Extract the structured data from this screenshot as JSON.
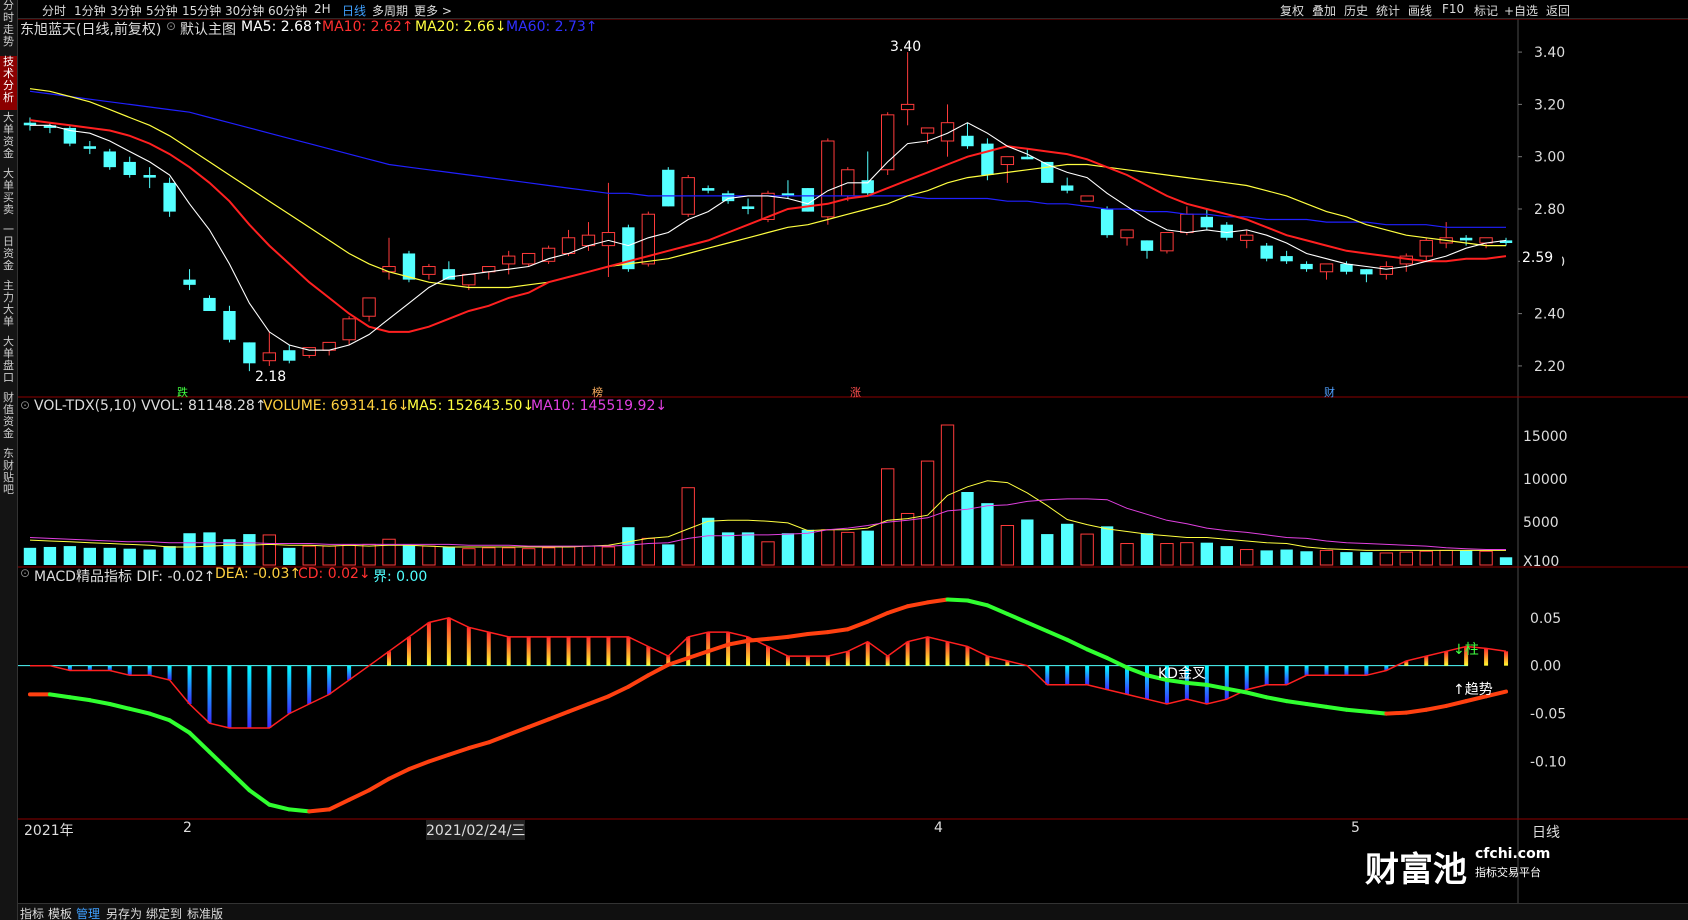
{
  "sidebar": [
    "分时走势",
    "技术分析",
    "大单资金",
    "大单买卖",
    "一日资金",
    "主力大单",
    "大单盘口",
    "财值资金",
    "东财贴吧"
  ],
  "periods": [
    "分时",
    "1分钟",
    "3分钟",
    "5分钟",
    "15分钟",
    "30分钟",
    "60分钟",
    "2H",
    "日线",
    "多周期",
    "更多 >"
  ],
  "tools": [
    "复权",
    "叠加",
    "历史",
    "统计",
    "画线",
    "F10",
    "标记",
    "+自选",
    "返回"
  ],
  "main_header": {
    "title": "东旭蓝天(日线,前复权)",
    "template": "默认主图",
    "ma5": "MA5: 2.68↑",
    "ma10": "MA10: 2.62↑",
    "ma20": "MA20: 2.66↓",
    "ma60": "MA60: 2.73↑"
  },
  "vol_header": {
    "name": "VOL-TDX(5,10) VVOL: 81148.28↑",
    "volume": "VOLUME: 69314.16↓",
    "ma5": "MA5: 152643.50↓",
    "ma10": "MA10: 145519.92↓"
  },
  "macd_header": {
    "name": "MACD精品指标 DIF: -0.02↑",
    "dea": "DEA: -0.03↑",
    "cd": "CD: 0.02↓",
    "jie": "界: 0.00"
  },
  "price_axis": [
    "3.40",
    "3.20",
    "3.00",
    "2.80",
    "2.60",
    "2.40",
    "2.20"
  ],
  "price_marker": "2.59",
  "vol_axis": [
    "15000",
    "10000",
    "5000",
    "X100"
  ],
  "macd_axis": [
    "0.05",
    "0.00",
    "-0.05",
    "-0.10"
  ],
  "annotations": {
    "high": "3.40",
    "low": "2.18",
    "kd": "KD金叉",
    "zhu": "↓柱",
    "trend": "↑趋势",
    "marks": [
      "跌",
      "榜",
      "涨",
      "财"
    ]
  },
  "dates": [
    "2021年",
    "2",
    "2021/02/24/三",
    "4",
    "5"
  ],
  "period_label": "日线",
  "bottom_tabs": [
    "指标",
    "模板",
    "管理",
    "另存为",
    "绑定到",
    "标准版"
  ],
  "logo": {
    "brand": "财富池",
    "site": "cfchi.com",
    "slogan": "指标交易平台"
  },
  "colors": {
    "up": "#ff3b3b",
    "down": "#54ffff",
    "ma5": "#ffffff",
    "ma10": "#ff2020",
    "ma20": "#ffff40",
    "ma60": "#2020ff"
  },
  "chart_data": {
    "type": "candlestick",
    "price_ylim": [
      2.15,
      3.45
    ],
    "candles": [
      [
        3.13,
        3.15,
        3.1,
        3.12
      ],
      [
        3.12,
        3.13,
        3.09,
        3.11
      ],
      [
        3.11,
        3.12,
        3.04,
        3.05
      ],
      [
        3.04,
        3.06,
        3.01,
        3.03
      ],
      [
        3.02,
        3.03,
        2.95,
        2.96
      ],
      [
        2.98,
        3.0,
        2.92,
        2.93
      ],
      [
        2.93,
        2.96,
        2.88,
        2.92
      ],
      [
        2.9,
        2.92,
        2.77,
        2.79
      ],
      [
        2.53,
        2.57,
        2.49,
        2.51
      ],
      [
        2.46,
        2.47,
        2.41,
        2.41
      ],
      [
        2.41,
        2.43,
        2.29,
        2.3
      ],
      [
        2.29,
        2.29,
        2.18,
        2.21
      ],
      [
        2.22,
        2.33,
        2.2,
        2.25
      ],
      [
        2.26,
        2.28,
        2.21,
        2.22
      ],
      [
        2.24,
        2.27,
        2.23,
        2.27
      ],
      [
        2.26,
        2.29,
        2.24,
        2.29
      ],
      [
        2.3,
        2.39,
        2.28,
        2.38
      ],
      [
        2.39,
        2.46,
        2.37,
        2.46
      ],
      [
        2.56,
        2.69,
        2.53,
        2.58
      ],
      [
        2.63,
        2.64,
        2.52,
        2.53
      ],
      [
        2.55,
        2.59,
        2.53,
        2.58
      ],
      [
        2.57,
        2.6,
        2.53,
        2.53
      ],
      [
        2.51,
        2.55,
        2.49,
        2.55
      ],
      [
        2.56,
        2.58,
        2.53,
        2.58
      ],
      [
        2.59,
        2.64,
        2.55,
        2.62
      ],
      [
        2.59,
        2.63,
        2.58,
        2.63
      ],
      [
        2.6,
        2.66,
        2.59,
        2.65
      ],
      [
        2.63,
        2.72,
        2.62,
        2.69
      ],
      [
        2.66,
        2.75,
        2.64,
        2.7
      ],
      [
        2.66,
        2.9,
        2.54,
        2.71
      ],
      [
        2.73,
        2.74,
        2.56,
        2.57
      ],
      [
        2.59,
        2.79,
        2.58,
        2.78
      ],
      [
        2.95,
        2.96,
        2.81,
        2.81
      ],
      [
        2.78,
        2.93,
        2.77,
        2.92
      ],
      [
        2.88,
        2.89,
        2.86,
        2.87
      ],
      [
        2.86,
        2.87,
        2.82,
        2.83
      ],
      [
        2.81,
        2.84,
        2.78,
        2.8
      ],
      [
        2.76,
        2.87,
        2.75,
        2.86
      ],
      [
        2.86,
        2.91,
        2.84,
        2.85
      ],
      [
        2.88,
        2.88,
        2.79,
        2.79
      ],
      [
        2.77,
        3.07,
        2.74,
        3.06
      ],
      [
        2.85,
        2.96,
        2.83,
        2.95
      ],
      [
        2.91,
        3.02,
        2.85,
        2.86
      ],
      [
        2.95,
        3.17,
        2.93,
        3.16
      ],
      [
        3.18,
        3.4,
        3.12,
        3.2
      ],
      [
        3.09,
        3.11,
        3.05,
        3.11
      ],
      [
        3.06,
        3.2,
        3.0,
        3.13
      ],
      [
        3.08,
        3.13,
        3.03,
        3.04
      ],
      [
        3.05,
        3.07,
        2.91,
        2.93
      ],
      [
        2.97,
        3.0,
        2.9,
        3.0
      ],
      [
        3.0,
        3.03,
        2.99,
        2.99
      ],
      [
        2.98,
        2.98,
        2.9,
        2.9
      ],
      [
        2.89,
        2.92,
        2.86,
        2.87
      ],
      [
        2.83,
        2.85,
        2.83,
        2.85
      ],
      [
        2.8,
        2.81,
        2.69,
        2.7
      ],
      [
        2.69,
        2.72,
        2.66,
        2.72
      ],
      [
        2.68,
        2.68,
        2.61,
        2.64
      ],
      [
        2.64,
        2.71,
        2.63,
        2.71
      ],
      [
        2.71,
        2.81,
        2.7,
        2.78
      ],
      [
        2.77,
        2.8,
        2.72,
        2.73
      ],
      [
        2.74,
        2.75,
        2.68,
        2.69
      ],
      [
        2.68,
        2.72,
        2.65,
        2.7
      ],
      [
        2.66,
        2.67,
        2.6,
        2.61
      ],
      [
        2.62,
        2.64,
        2.59,
        2.6
      ],
      [
        2.59,
        2.6,
        2.56,
        2.57
      ],
      [
        2.56,
        2.58,
        2.53,
        2.59
      ],
      [
        2.59,
        2.6,
        2.55,
        2.56
      ],
      [
        2.57,
        2.57,
        2.52,
        2.55
      ],
      [
        2.55,
        2.6,
        2.53,
        2.58
      ],
      [
        2.59,
        2.63,
        2.56,
        2.62
      ],
      [
        2.62,
        2.69,
        2.6,
        2.68
      ],
      [
        2.67,
        2.75,
        2.65,
        2.69
      ],
      [
        2.69,
        2.7,
        2.66,
        2.68
      ],
      [
        2.67,
        2.69,
        2.65,
        2.69
      ],
      [
        2.68,
        2.69,
        2.66,
        2.67
      ]
    ],
    "ma5": [
      3.12,
      3.12,
      3.1,
      3.09,
      3.06,
      3.02,
      2.98,
      2.93,
      2.82,
      2.72,
      2.59,
      2.44,
      2.33,
      2.28,
      2.26,
      2.26,
      2.28,
      2.32,
      2.38,
      2.44,
      2.5,
      2.54,
      2.55,
      2.56,
      2.57,
      2.58,
      2.61,
      2.63,
      2.66,
      2.68,
      2.66,
      2.69,
      2.71,
      2.76,
      2.79,
      2.84,
      2.85,
      2.85,
      2.84,
      2.82,
      2.87,
      2.9,
      2.9,
      2.98,
      3.05,
      3.06,
      3.09,
      3.13,
      3.09,
      3.04,
      3.01,
      2.97,
      2.94,
      2.92,
      2.86,
      2.81,
      2.76,
      2.72,
      2.71,
      2.72,
      2.71,
      2.72,
      2.7,
      2.67,
      2.63,
      2.61,
      2.59,
      2.58,
      2.57,
      2.58,
      2.6,
      2.62,
      2.65,
      2.67,
      2.68
    ],
    "ma10": [
      3.14,
      3.13,
      3.12,
      3.11,
      3.1,
      3.08,
      3.05,
      3.01,
      2.96,
      2.9,
      2.83,
      2.74,
      2.66,
      2.59,
      2.52,
      2.46,
      2.4,
      2.35,
      2.33,
      2.33,
      2.35,
      2.38,
      2.41,
      2.43,
      2.46,
      2.48,
      2.52,
      2.54,
      2.56,
      2.58,
      2.6,
      2.62,
      2.64,
      2.66,
      2.68,
      2.71,
      2.74,
      2.77,
      2.8,
      2.81,
      2.82,
      2.84,
      2.85,
      2.88,
      2.91,
      2.94,
      2.97,
      3.0,
      3.02,
      3.04,
      3.03,
      3.02,
      3.01,
      2.99,
      2.96,
      2.93,
      2.89,
      2.85,
      2.82,
      2.8,
      2.78,
      2.76,
      2.73,
      2.7,
      2.68,
      2.66,
      2.64,
      2.63,
      2.62,
      2.61,
      2.6,
      2.6,
      2.61,
      2.61,
      2.62
    ],
    "ma20": [
      3.26,
      3.25,
      3.23,
      3.21,
      3.18,
      3.15,
      3.12,
      3.08,
      3.03,
      2.98,
      2.93,
      2.88,
      2.83,
      2.78,
      2.73,
      2.68,
      2.63,
      2.59,
      2.56,
      2.54,
      2.52,
      2.51,
      2.5,
      2.5,
      2.5,
      2.51,
      2.52,
      2.54,
      2.56,
      2.58,
      2.59,
      2.6,
      2.61,
      2.63,
      2.65,
      2.67,
      2.69,
      2.71,
      2.73,
      2.74,
      2.76,
      2.78,
      2.8,
      2.82,
      2.85,
      2.87,
      2.9,
      2.92,
      2.93,
      2.94,
      2.95,
      2.96,
      2.97,
      2.97,
      2.96,
      2.95,
      2.94,
      2.93,
      2.92,
      2.91,
      2.9,
      2.89,
      2.87,
      2.85,
      2.82,
      2.79,
      2.77,
      2.74,
      2.72,
      2.7,
      2.69,
      2.68,
      2.67,
      2.66,
      2.66
    ],
    "ma60": [
      3.25,
      3.24,
      3.23,
      3.22,
      3.21,
      3.2,
      3.19,
      3.18,
      3.17,
      3.15,
      3.13,
      3.11,
      3.09,
      3.07,
      3.05,
      3.03,
      3.01,
      2.99,
      2.97,
      2.96,
      2.95,
      2.94,
      2.93,
      2.92,
      2.91,
      2.9,
      2.89,
      2.88,
      2.87,
      2.86,
      2.86,
      2.85,
      2.85,
      2.85,
      2.85,
      2.85,
      2.85,
      2.85,
      2.85,
      2.85,
      2.85,
      2.85,
      2.85,
      2.85,
      2.85,
      2.84,
      2.84,
      2.84,
      2.84,
      2.83,
      2.83,
      2.82,
      2.82,
      2.81,
      2.8,
      2.8,
      2.79,
      2.79,
      2.78,
      2.78,
      2.77,
      2.77,
      2.76,
      2.76,
      2.76,
      2.75,
      2.75,
      2.75,
      2.74,
      2.74,
      2.74,
      2.73,
      2.73,
      2.73,
      2.73
    ],
    "volume_ylim": [
      0,
      17000
    ],
    "volume": [
      2000,
      2100,
      2200,
      2000,
      2000,
      1900,
      1800,
      2200,
      3700,
      3800,
      3000,
      3600,
      3500,
      2000,
      2200,
      2200,
      2300,
      2400,
      3000,
      2300,
      2200,
      2100,
      1900,
      2000,
      2000,
      1900,
      2000,
      2100,
      2200,
      2100,
      4400,
      3100,
      2400,
      9000,
      5500,
      3800,
      3800,
      2700,
      3700,
      4100,
      4100,
      3800,
      4000,
      11200,
      6000,
      12100,
      16300,
      8500,
      7200,
      4600,
      5300,
      3600,
      4800,
      3600,
      4500,
      2500,
      3700,
      2500,
      2600,
      2600,
      2200,
      1800,
      1700,
      1800,
      1600,
      1700,
      1500,
      1500,
      1400,
      1500,
      1600,
      1700,
      1700,
      1600,
      900
    ],
    "vol_ma5": [
      2900,
      2800,
      2700,
      2600,
      2500,
      2400,
      2300,
      2100,
      2100,
      2200,
      2300,
      2300,
      2400,
      2300,
      2300,
      2200,
      2300,
      2200,
      2300,
      2300,
      2200,
      2100,
      2100,
      2100,
      2100,
      2100,
      2100,
      2100,
      2200,
      2300,
      2700,
      3100,
      3300,
      4200,
      5100,
      5200,
      5200,
      5100,
      4900,
      4000,
      4100,
      4100,
      4300,
      5200,
      5400,
      5800,
      8100,
      9100,
      9800,
      9600,
      8400,
      6900,
      5300,
      4700,
      4200,
      3900,
      3600,
      3400,
      3200,
      3200,
      3000,
      2800,
      2600,
      2500,
      2100,
      1900,
      1800,
      1700,
      1700,
      1700,
      1700,
      1700,
      1700,
      1700,
      1700
    ],
    "vol_ma10": [
      3200,
      3100,
      3000,
      2900,
      2800,
      2700,
      2700,
      2600,
      2600,
      2600,
      2600,
      2600,
      2500,
      2500,
      2500,
      2400,
      2400,
      2400,
      2400,
      2400,
      2400,
      2400,
      2300,
      2300,
      2300,
      2200,
      2200,
      2200,
      2200,
      2200,
      2300,
      2500,
      2600,
      3100,
      3400,
      3400,
      3500,
      3500,
      3600,
      3700,
      4100,
      4300,
      4600,
      5000,
      5200,
      5500,
      6300,
      6500,
      6900,
      7000,
      7400,
      7600,
      7700,
      7700,
      7600,
      6600,
      5900,
      5200,
      4800,
      4300,
      4000,
      3800,
      3500,
      3200,
      3100,
      2800,
      2600,
      2500,
      2400,
      2300,
      2200,
      2000,
      1900,
      1800,
      1800
    ],
    "macd_ylim": [
      -0.16,
      0.08
    ],
    "macd_hist": [
      0,
      0,
      -0.005,
      -0.005,
      -0.005,
      -0.01,
      -0.01,
      -0.015,
      -0.04,
      -0.06,
      -0.065,
      -0.065,
      -0.065,
      -0.05,
      -0.04,
      -0.03,
      -0.015,
      0,
      0.015,
      0.03,
      0.045,
      0.05,
      0.04,
      0.035,
      0.03,
      0.03,
      0.03,
      0.03,
      0.03,
      0.03,
      0.03,
      0.02,
      0.01,
      0.03,
      0.035,
      0.035,
      0.03,
      0.02,
      0.01,
      0.01,
      0.01,
      0.015,
      0.025,
      0.01,
      0.025,
      0.03,
      0.025,
      0.02,
      0.01,
      0.005,
      0,
      -0.02,
      -0.02,
      -0.02,
      -0.025,
      -0.03,
      -0.035,
      -0.04,
      -0.035,
      -0.04,
      -0.035,
      -0.025,
      -0.02,
      -0.02,
      -0.01,
      -0.01,
      -0.01,
      -0.01,
      -0.005,
      0.005,
      0.01,
      0.015,
      0.02,
      0.018,
      0.015
    ],
    "dif": [
      -0.03,
      -0.03,
      -0.033,
      -0.036,
      -0.04,
      -0.045,
      -0.05,
      -0.057,
      -0.07,
      -0.09,
      -0.11,
      -0.13,
      -0.145,
      -0.15,
      -0.152,
      -0.15,
      -0.14,
      -0.13,
      -0.118,
      -0.108,
      -0.1,
      -0.093,
      -0.086,
      -0.08,
      -0.072,
      -0.064,
      -0.056,
      -0.048,
      -0.04,
      -0.032,
      -0.022,
      -0.01,
      0.001,
      0.008,
      0.015,
      0.022,
      0.026,
      0.028,
      0.03,
      0.033,
      0.035,
      0.038,
      0.046,
      0.055,
      0.062,
      0.066,
      0.069,
      0.068,
      0.063,
      0.054,
      0.045,
      0.036,
      0.027,
      0.017,
      0.008,
      -0.002,
      -0.01,
      -0.015,
      -0.018,
      -0.02,
      -0.024,
      -0.028,
      -0.033,
      -0.037,
      -0.04,
      -0.043,
      -0.046,
      -0.048,
      -0.05,
      -0.049,
      -0.046,
      -0.042,
      -0.037,
      -0.032,
      -0.027
    ]
  }
}
